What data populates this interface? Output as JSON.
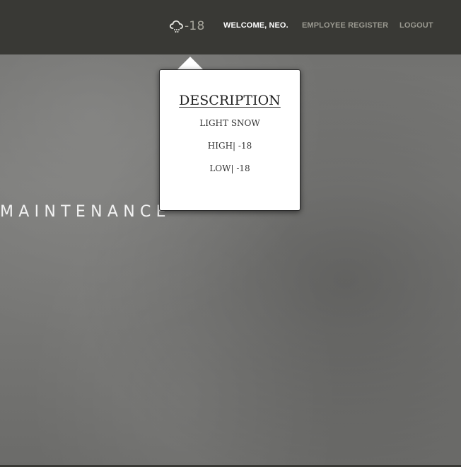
{
  "navbar": {
    "weather": {
      "icon": "cloud-snow-icon",
      "temp": "-18"
    },
    "welcome": "WELCOME, NEO.",
    "employee_register": "EMPLOYEE REGISTER",
    "logout": "LOGOUT"
  },
  "hero": {
    "title": "MAINTENANCE"
  },
  "popover": {
    "title": "DESCRIPTION",
    "condition": "LIGHT SNOW",
    "high": "HIGH| -18",
    "low": "LOW| -18"
  },
  "colors": {
    "navbar_bg": "#393935",
    "nav_active": "#ffffff",
    "nav_muted": "#9a9990",
    "weather_text": "#a6a59b",
    "popover_bg": "#ffffff"
  }
}
